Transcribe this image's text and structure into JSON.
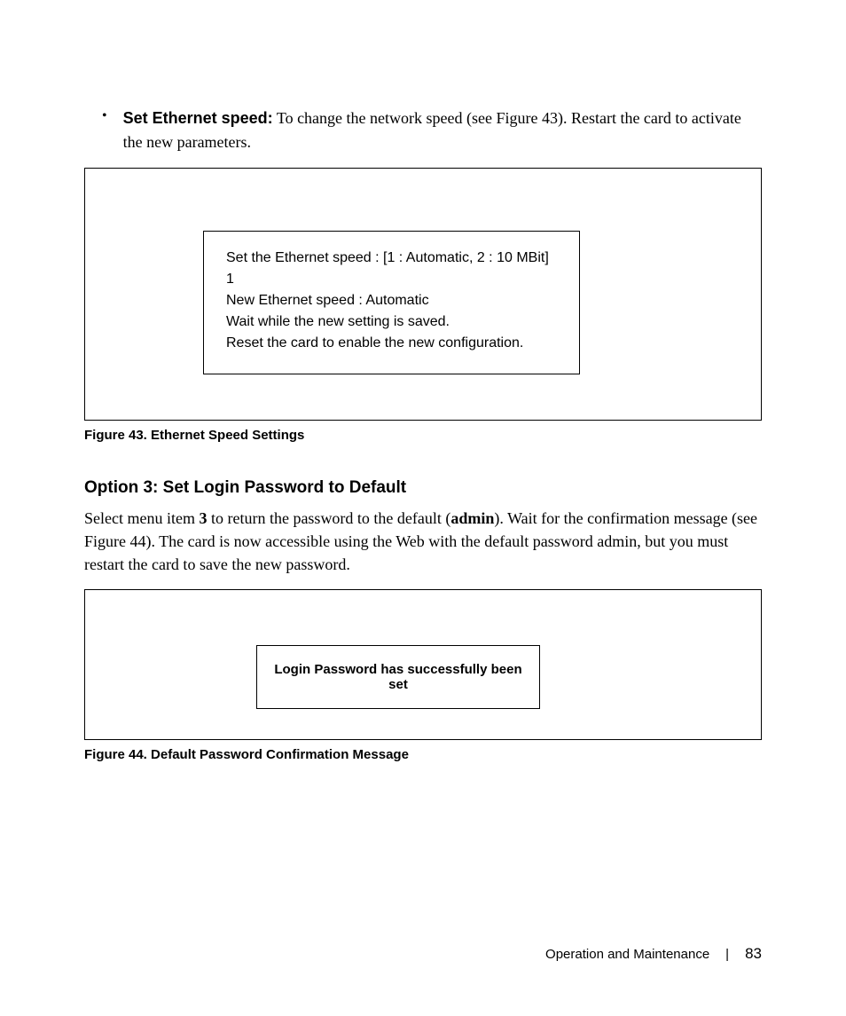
{
  "bullet": {
    "symbol": "•",
    "label_bold": "Set Ethernet speed:",
    "label_rest": " To change the network speed (see Figure 43). Restart the card to activate the new parameters."
  },
  "figure43": {
    "lines": [
      "Set the Ethernet speed : [1 : Automatic, 2 : 10 MBit]",
      "1",
      "New Ethernet speed : Automatic",
      "Wait while the new setting is saved.",
      "Reset the card to enable the new configuration."
    ],
    "caption": "Figure 43. Ethernet Speed Settings"
  },
  "section": {
    "heading": "Option 3: Set Login Password to Default",
    "body_p1_a": "Select menu item ",
    "body_p1_b": "3",
    "body_p1_c": " to return the password to the default (",
    "body_p1_d": "admin",
    "body_p1_e": "). Wait for the confirmation message (see Figure 44). The card is now accessible using the Web with the default password admin, but you must restart the card to save the new password."
  },
  "figure44": {
    "message": "Login Password has successfully been set",
    "caption": "Figure 44. Default Password Confirmation Message"
  },
  "footer": {
    "section": "Operation and Maintenance",
    "divider": "|",
    "page": "83"
  }
}
